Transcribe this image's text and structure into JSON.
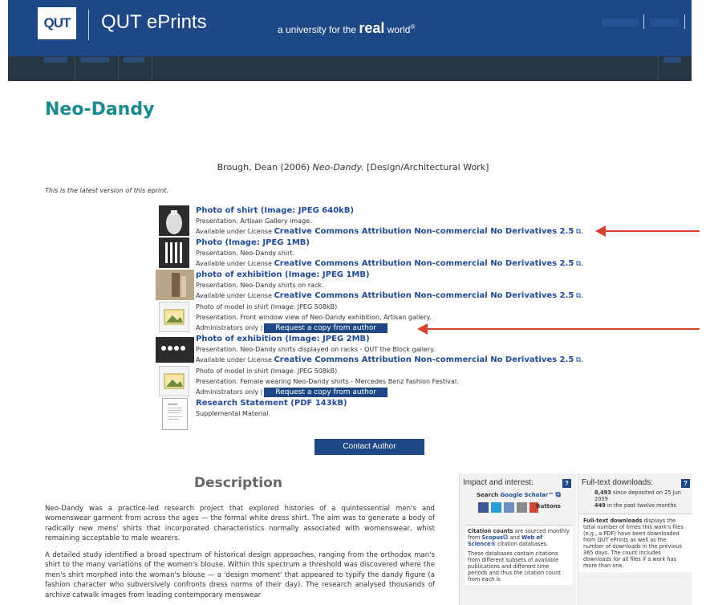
{
  "header": {
    "logo_text": "QUT",
    "title": "QUT ePrints",
    "tagline_pre": "a university for the ",
    "tagline_real": "real",
    "tagline_post": " world",
    "tagline_mark": "®"
  },
  "page": {
    "title": "Neo-Dandy",
    "citation_author": "Brough, Dean (2006) ",
    "citation_title": "Neo-Dandy.",
    "citation_type": " [Design/Architectural Work]",
    "latest_note": "This is the latest version of this eprint."
  },
  "files": [
    {
      "title": "Photo of shirt (Image: JPEG 640kB)",
      "line1": "Presentation. Artisan Gallery image.",
      "license_prefix": "Available under License ",
      "license": "Creative Commons Attribution Non-commercial No Derivatives 2.5"
    },
    {
      "title": "Photo (Image: JPEG 1MB)",
      "line1": "Presentation. Neo-Dandy shirt.",
      "license_prefix": "Available under License ",
      "license": "Creative Commons Attribution Non-commercial No Derivatives 2.5"
    },
    {
      "title": "photo of exhibition (Image: JPEG 1MB)",
      "line1": "Presentation. Neo-Dandy shirts on rack.",
      "license_prefix": "Available under License ",
      "license": "Creative Commons Attribution Non-commercial No Derivatives 2.5"
    },
    {
      "title": "Photo of model in shirt (Image: JPEG 508kB)",
      "line1": "Presentation. Front window view of Neo-Dandy exhibition, Artisan gallery.",
      "restricted": "Administrators only |",
      "request": "Request a copy from author"
    },
    {
      "title": "Photo of exhibition (Image: JPEG 2MB)",
      "line1": "Presentation. Neo-Dandy shirts displayed on racks - QUT the Block gallery.",
      "license_prefix": "Available under License ",
      "license": "Creative Commons Attribution Non-commercial No Derivatives 2.5"
    },
    {
      "title": "Photo of model in shirt (Image: JPEG 508kB)",
      "line1": "Presentation. Female wearing Neo-Dandy shirts - Mercedes Benz Fashion Festival.",
      "restricted": "Administrators only |",
      "request": "Request a copy from author"
    },
    {
      "title": "Research Statement (PDF 143kB)",
      "line1": "Supplemental Material."
    }
  ],
  "contact_button": "Contact Author",
  "description": {
    "heading": "Description",
    "p1": "Neo-Dandy was a practice-led research project that explored histories of a quintessential men's and womenswear garment from across the ages — the formal white dress shirt. The aim was to generate a body of radically new mens' shirts that incorporated characteristics normally associated with womenswear, whist remaining acceptable to male wearers.",
    "p2": "A detailed study identified a broad spectrum of historical design approaches, ranging from the orthodox man's shirt to the many variations of the women's blouse. Within this spectrum a threshold was discovered where the men's shirt morphed into the woman's blouse — a 'design moment' that appeared to typify the dandy figure (a fashion character who subversively confronts dress norms of their day). The research analysed thousands of archive catwalk images from leading contemporary menswear"
  },
  "impact": {
    "heading": "Impact and interest:",
    "help": "?",
    "search_pre": "Search ",
    "search_link": "Google Scholar™",
    "buttons_word": "Buttons",
    "citation_strong": "Citation counts",
    "citation_text": " are sourced monthly from ",
    "scopus": "Scopus",
    "and": " and ",
    "wos": "Web of Science®",
    "citation_tail": " citation databases.",
    "db_text": "These databases contain citations from different subsets of available publications and different time periods and thus the citation count from each is"
  },
  "downloads": {
    "heading": "Full-text downloads:",
    "help": "?",
    "total": "8,493",
    "total_text": " since deposited on 25 Jun 2009",
    "recent": "449",
    "recent_text": " in the past twelve months",
    "info_strong": "Full-text downloads",
    "info_text": " displays the total number of times this work's files (e.g., a PDF) have been downloaded from QUT ePrints as well as the number of downloads in the previous 365 days. The count includes downloads for all files if a work has more than one."
  },
  "colors": {
    "header_blue": "#1d4785",
    "nav_dark": "#283643",
    "title_teal": "#1a8a8e",
    "link_blue": "#1f4b97",
    "arrow_red": "#d6412d"
  }
}
